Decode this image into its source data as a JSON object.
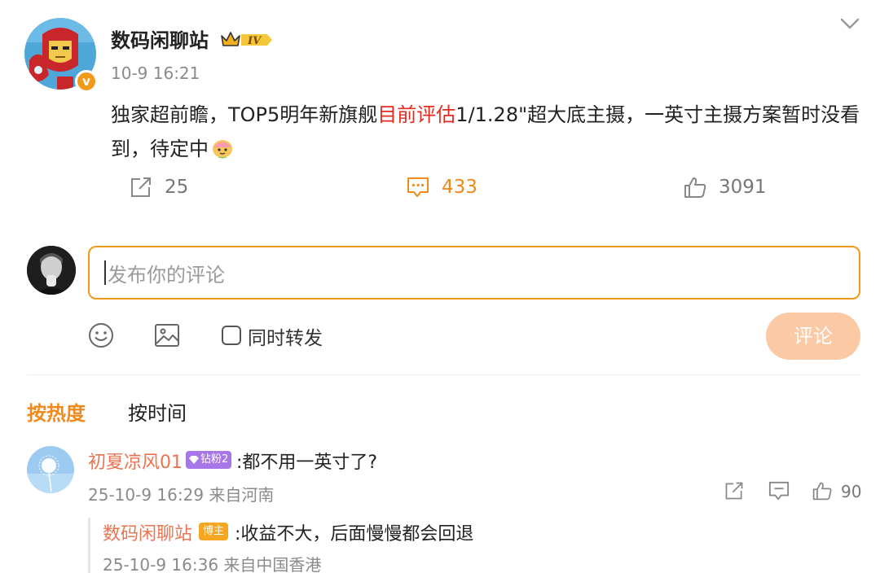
{
  "post": {
    "author": "数码闲聊站",
    "level_badge": "IV",
    "time": "10-9 16:21",
    "text_before": "独家超前瞻，TOP5明年新旗舰",
    "text_highlight": "目前评估",
    "text_after": "1/1.28\"超大底主摄，一英寸主摄方案暂时没看到，待定中",
    "emoji": "peach-emoji",
    "verified_icon": "v-verified-icon",
    "highlight_color": "#e8291d",
    "actions": {
      "repost_count": "25",
      "comment_count": "433",
      "like_count": "3091"
    }
  },
  "composer": {
    "placeholder": "发布你的评论",
    "also_repost_label": "同时转发",
    "submit_label": "评论",
    "accent_color": "#f19a1a"
  },
  "sort_tabs": {
    "hot": "按热度",
    "time": "按时间"
  },
  "comments": [
    {
      "user": "初夏凉风01",
      "badge": "钻粉2",
      "text": ":都不用一英寸了?",
      "meta": "25-10-9 16:29 来自河南",
      "like_count": "90",
      "reply": {
        "user": "数码闲聊站",
        "badge": "博主",
        "text": ":收益不大，后面慢慢都会回退",
        "meta": "25-10-9 16:36 来自中国香港"
      }
    }
  ],
  "colors": {
    "orange": "#f08a1c",
    "username": "#eb7350",
    "fan_badge": "#a776e8",
    "owner_badge": "#f5a623"
  }
}
